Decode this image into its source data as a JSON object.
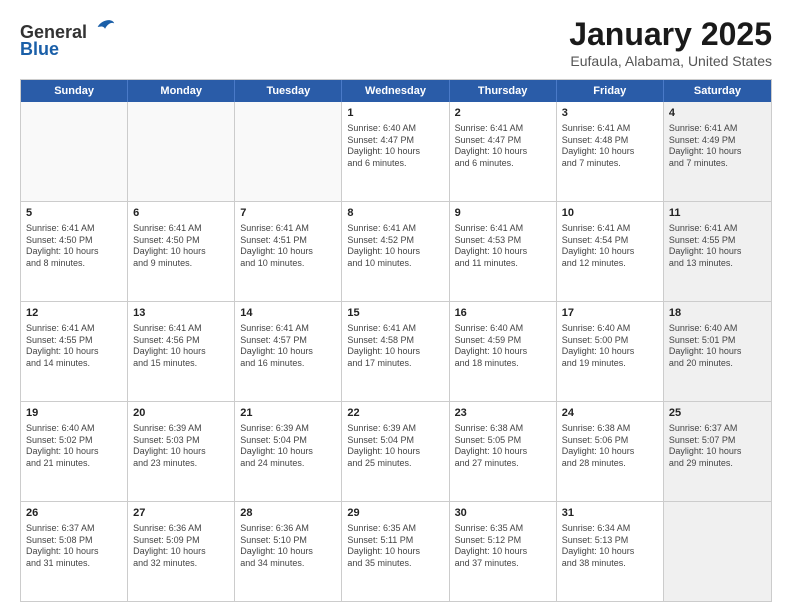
{
  "header": {
    "logo_general": "General",
    "logo_blue": "Blue",
    "title": "January 2025",
    "subtitle": "Eufaula, Alabama, United States"
  },
  "weekdays": [
    "Sunday",
    "Monday",
    "Tuesday",
    "Wednesday",
    "Thursday",
    "Friday",
    "Saturday"
  ],
  "weeks": [
    [
      {
        "day": "",
        "info": "",
        "shaded": false,
        "empty": true
      },
      {
        "day": "",
        "info": "",
        "shaded": false,
        "empty": true
      },
      {
        "day": "",
        "info": "",
        "shaded": false,
        "empty": true
      },
      {
        "day": "1",
        "info": "Sunrise: 6:40 AM\nSunset: 4:47 PM\nDaylight: 10 hours\nand 6 minutes.",
        "shaded": false,
        "empty": false
      },
      {
        "day": "2",
        "info": "Sunrise: 6:41 AM\nSunset: 4:47 PM\nDaylight: 10 hours\nand 6 minutes.",
        "shaded": false,
        "empty": false
      },
      {
        "day": "3",
        "info": "Sunrise: 6:41 AM\nSunset: 4:48 PM\nDaylight: 10 hours\nand 7 minutes.",
        "shaded": false,
        "empty": false
      },
      {
        "day": "4",
        "info": "Sunrise: 6:41 AM\nSunset: 4:49 PM\nDaylight: 10 hours\nand 7 minutes.",
        "shaded": true,
        "empty": false
      }
    ],
    [
      {
        "day": "5",
        "info": "Sunrise: 6:41 AM\nSunset: 4:50 PM\nDaylight: 10 hours\nand 8 minutes.",
        "shaded": false,
        "empty": false
      },
      {
        "day": "6",
        "info": "Sunrise: 6:41 AM\nSunset: 4:50 PM\nDaylight: 10 hours\nand 9 minutes.",
        "shaded": false,
        "empty": false
      },
      {
        "day": "7",
        "info": "Sunrise: 6:41 AM\nSunset: 4:51 PM\nDaylight: 10 hours\nand 10 minutes.",
        "shaded": false,
        "empty": false
      },
      {
        "day": "8",
        "info": "Sunrise: 6:41 AM\nSunset: 4:52 PM\nDaylight: 10 hours\nand 10 minutes.",
        "shaded": false,
        "empty": false
      },
      {
        "day": "9",
        "info": "Sunrise: 6:41 AM\nSunset: 4:53 PM\nDaylight: 10 hours\nand 11 minutes.",
        "shaded": false,
        "empty": false
      },
      {
        "day": "10",
        "info": "Sunrise: 6:41 AM\nSunset: 4:54 PM\nDaylight: 10 hours\nand 12 minutes.",
        "shaded": false,
        "empty": false
      },
      {
        "day": "11",
        "info": "Sunrise: 6:41 AM\nSunset: 4:55 PM\nDaylight: 10 hours\nand 13 minutes.",
        "shaded": true,
        "empty": false
      }
    ],
    [
      {
        "day": "12",
        "info": "Sunrise: 6:41 AM\nSunset: 4:55 PM\nDaylight: 10 hours\nand 14 minutes.",
        "shaded": false,
        "empty": false
      },
      {
        "day": "13",
        "info": "Sunrise: 6:41 AM\nSunset: 4:56 PM\nDaylight: 10 hours\nand 15 minutes.",
        "shaded": false,
        "empty": false
      },
      {
        "day": "14",
        "info": "Sunrise: 6:41 AM\nSunset: 4:57 PM\nDaylight: 10 hours\nand 16 minutes.",
        "shaded": false,
        "empty": false
      },
      {
        "day": "15",
        "info": "Sunrise: 6:41 AM\nSunset: 4:58 PM\nDaylight: 10 hours\nand 17 minutes.",
        "shaded": false,
        "empty": false
      },
      {
        "day": "16",
        "info": "Sunrise: 6:40 AM\nSunset: 4:59 PM\nDaylight: 10 hours\nand 18 minutes.",
        "shaded": false,
        "empty": false
      },
      {
        "day": "17",
        "info": "Sunrise: 6:40 AM\nSunset: 5:00 PM\nDaylight: 10 hours\nand 19 minutes.",
        "shaded": false,
        "empty": false
      },
      {
        "day": "18",
        "info": "Sunrise: 6:40 AM\nSunset: 5:01 PM\nDaylight: 10 hours\nand 20 minutes.",
        "shaded": true,
        "empty": false
      }
    ],
    [
      {
        "day": "19",
        "info": "Sunrise: 6:40 AM\nSunset: 5:02 PM\nDaylight: 10 hours\nand 21 minutes.",
        "shaded": false,
        "empty": false
      },
      {
        "day": "20",
        "info": "Sunrise: 6:39 AM\nSunset: 5:03 PM\nDaylight: 10 hours\nand 23 minutes.",
        "shaded": false,
        "empty": false
      },
      {
        "day": "21",
        "info": "Sunrise: 6:39 AM\nSunset: 5:04 PM\nDaylight: 10 hours\nand 24 minutes.",
        "shaded": false,
        "empty": false
      },
      {
        "day": "22",
        "info": "Sunrise: 6:39 AM\nSunset: 5:04 PM\nDaylight: 10 hours\nand 25 minutes.",
        "shaded": false,
        "empty": false
      },
      {
        "day": "23",
        "info": "Sunrise: 6:38 AM\nSunset: 5:05 PM\nDaylight: 10 hours\nand 27 minutes.",
        "shaded": false,
        "empty": false
      },
      {
        "day": "24",
        "info": "Sunrise: 6:38 AM\nSunset: 5:06 PM\nDaylight: 10 hours\nand 28 minutes.",
        "shaded": false,
        "empty": false
      },
      {
        "day": "25",
        "info": "Sunrise: 6:37 AM\nSunset: 5:07 PM\nDaylight: 10 hours\nand 29 minutes.",
        "shaded": true,
        "empty": false
      }
    ],
    [
      {
        "day": "26",
        "info": "Sunrise: 6:37 AM\nSunset: 5:08 PM\nDaylight: 10 hours\nand 31 minutes.",
        "shaded": false,
        "empty": false
      },
      {
        "day": "27",
        "info": "Sunrise: 6:36 AM\nSunset: 5:09 PM\nDaylight: 10 hours\nand 32 minutes.",
        "shaded": false,
        "empty": false
      },
      {
        "day": "28",
        "info": "Sunrise: 6:36 AM\nSunset: 5:10 PM\nDaylight: 10 hours\nand 34 minutes.",
        "shaded": false,
        "empty": false
      },
      {
        "day": "29",
        "info": "Sunrise: 6:35 AM\nSunset: 5:11 PM\nDaylight: 10 hours\nand 35 minutes.",
        "shaded": false,
        "empty": false
      },
      {
        "day": "30",
        "info": "Sunrise: 6:35 AM\nSunset: 5:12 PM\nDaylight: 10 hours\nand 37 minutes.",
        "shaded": false,
        "empty": false
      },
      {
        "day": "31",
        "info": "Sunrise: 6:34 AM\nSunset: 5:13 PM\nDaylight: 10 hours\nand 38 minutes.",
        "shaded": false,
        "empty": false
      },
      {
        "day": "",
        "info": "",
        "shaded": true,
        "empty": true
      }
    ]
  ]
}
